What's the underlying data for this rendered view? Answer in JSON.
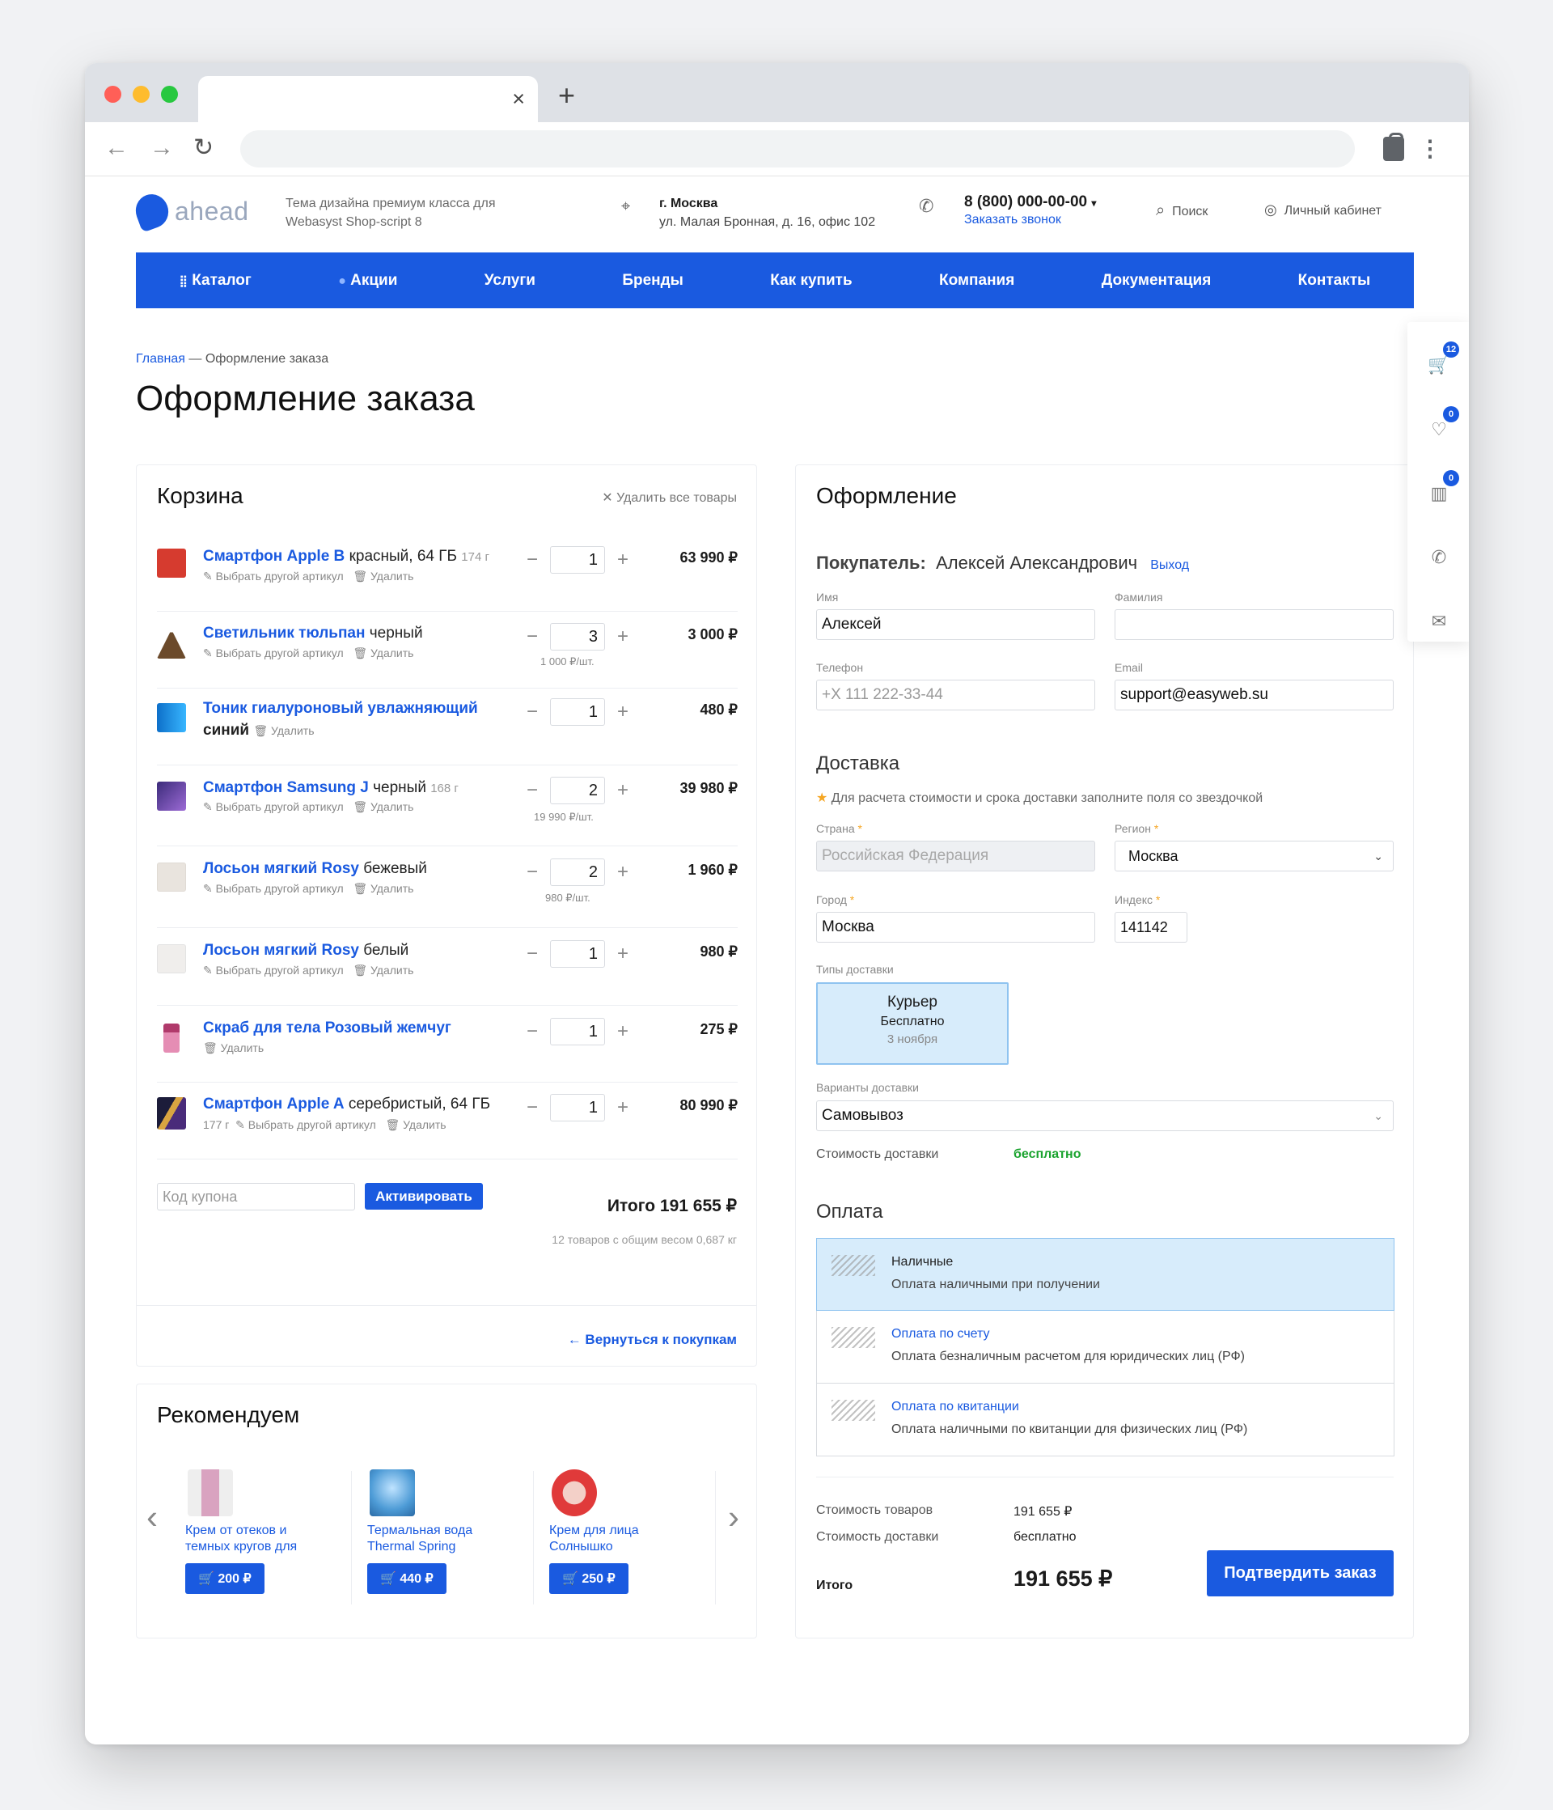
{
  "browser": {
    "tab_close": "×",
    "new_tab": "+",
    "back": "←",
    "forward": "→",
    "reload": "↻",
    "menu": "⋮"
  },
  "header": {
    "logo": "ahead",
    "tagline": "Тема дизайна премиум класса для Webasyst Shop-script 8",
    "city": "г. Москва",
    "address": "ул. Малая Бронная, д. 16, офис 102",
    "phone": "8 (800) 000-00-00",
    "callback": "Заказать звонок",
    "search": "Поиск",
    "account": "Личный кабинет"
  },
  "nav": [
    "Каталог",
    "Акции",
    "Услуги",
    "Бренды",
    "Как купить",
    "Компания",
    "Документация",
    "Контакты"
  ],
  "breadcrumb": {
    "home": "Главная",
    "sep": "—",
    "current": "Оформление заказа"
  },
  "page_title": "Оформление заказа",
  "cart": {
    "title": "Корзина",
    "clear_all": "Удалить все товары",
    "choose_variant": "Выбрать другой артикул",
    "remove": "Удалить",
    "items": [
      {
        "name": "Смартфон Apple B",
        "variant": "красный, 64 ГБ",
        "weight": "174 г",
        "qty": "1",
        "unit": "",
        "price": "63 990 ₽",
        "color": "#d63b2f"
      },
      {
        "name": "Светильник тюльпан",
        "variant": "черный",
        "weight": "",
        "qty": "3",
        "unit": "1 000 ₽/шт.",
        "price": "3 000 ₽",
        "color": "#6b4a2b"
      },
      {
        "name": "Тоник гиалуроновый увлажняющий",
        "variant": "синий",
        "weight": "",
        "qty": "1",
        "unit": "",
        "price": "480 ₽",
        "color": "#1e88e5"
      },
      {
        "name": "Смартфон Samsung J",
        "variant": "черный",
        "weight": "168 г",
        "qty": "2",
        "unit": "19 990 ₽/шт.",
        "price": "39 980 ₽",
        "color": "#6a3fa0"
      },
      {
        "name": "Лосьон мягкий Rosy",
        "variant": "бежевый",
        "weight": "",
        "qty": "2",
        "unit": "980 ₽/шт.",
        "price": "1 960 ₽",
        "color": "#e9e4de"
      },
      {
        "name": "Лосьон мягкий Rosy",
        "variant": "белый",
        "weight": "",
        "qty": "1",
        "unit": "",
        "price": "980 ₽",
        "color": "#eeeeee"
      },
      {
        "name": "Скраб для тела Розовый жемчуг",
        "variant": "",
        "weight": "",
        "qty": "1",
        "unit": "",
        "price": "275 ₽",
        "color": "#b03a6b"
      },
      {
        "name": "Смартфон Apple A",
        "variant": "серебристый, 64 ГБ",
        "weight": "177 г",
        "qty": "1",
        "unit": "",
        "price": "80 990 ₽",
        "color": "#2a2a4a"
      }
    ],
    "coupon_placeholder": "Код купона",
    "activate": "Активировать",
    "total": "Итого 191 655 ₽",
    "weight_note": "12 товаров с общим весом 0,687 кг",
    "back": "← Вернуться к покупкам"
  },
  "recommend": {
    "title": "Рекомендуем",
    "items": [
      {
        "name": "Крем от отеков и темных кругов для",
        "price": "🛒 200 ₽",
        "color": "#d9a3c0"
      },
      {
        "name": "Термальная вода Thermal Spring",
        "price": "🛒 440 ₽",
        "color": "#4d9bd6"
      },
      {
        "name": "Крем для лица Солнышко",
        "price": "🛒 250 ₽",
        "color": "#e03a3a"
      }
    ],
    "prev": "‹",
    "next": "›"
  },
  "checkout": {
    "title": "Оформление",
    "buyer_label": "Покупатель:",
    "buyer_name": "Алексей Александрович",
    "logout": "Выход",
    "first_name_label": "Имя",
    "first_name": "Алексей",
    "last_name_label": "Фамилия",
    "last_name": "",
    "phone_label": "Телефон",
    "phone_placeholder": "+X 111 222-33-44",
    "email_label": "Email",
    "email": "support@easyweb.su",
    "delivery_title": "Доставка",
    "delivery_hint": "Для расчета стоимости и срока доставки заполните поля со звездочкой",
    "country_label": "Страна",
    "country": "Российская Федерация",
    "region_label": "Регион",
    "region": "Москва",
    "city_label": "Город",
    "city": "Москва",
    "zip_label": "Индекс",
    "zip": "141142",
    "types_label": "Типы доставки",
    "courier": "Курьер",
    "courier_price": "Бесплатно",
    "courier_date": "3 ноября",
    "variants_label": "Варианты доставки",
    "variant": "Самовывоз",
    "delivery_cost_label": "Стоимость доставки",
    "delivery_cost": "бесплатно",
    "payment_title": "Оплата",
    "payments": [
      {
        "title": "Наличные",
        "desc": "Оплата наличными при получении"
      },
      {
        "title": "Оплата по счету",
        "desc": "Оплата безналичным расчетом для юридических лиц (РФ)"
      },
      {
        "title": "Оплата по квитанции",
        "desc": "Оплата наличными по квитанции для физических лиц (РФ)"
      }
    ],
    "goods_cost_label": "Стоимость товаров",
    "goods_cost": "191 655 ₽",
    "ship_cost_label": "Стоимость доставки",
    "ship_cost": "бесплатно",
    "total_label": "Итого",
    "total": "191 655 ₽",
    "confirm": "Подтвердить заказ"
  },
  "sidebar": {
    "cart_count": "12",
    "fav_count": "0",
    "compare_count": "0"
  }
}
